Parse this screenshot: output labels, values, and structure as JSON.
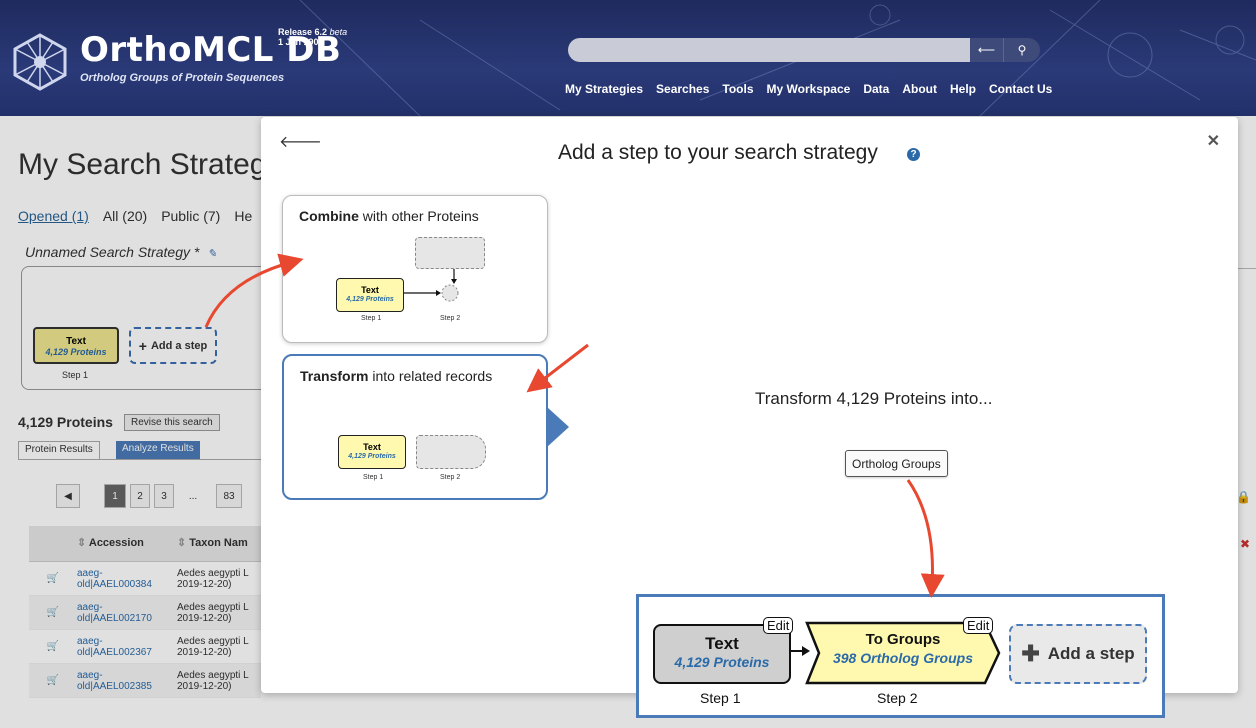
{
  "header": {
    "title": "OrthoMCL DB",
    "subtitle": "Ortholog Groups of Protein Sequences",
    "release": "Release 6.2",
    "release_tag": "beta",
    "release_date": "1 Jan 1900",
    "nav": [
      "My Strategies",
      "Searches",
      "Tools",
      "My Workspace",
      "Data",
      "About",
      "Help",
      "Contact Us"
    ]
  },
  "page": {
    "title": "My Search Strateg",
    "tabs": [
      "Opened (1)",
      "All (20)",
      "Public (7)",
      "He"
    ],
    "strategy_name": "Unnamed Search Strategy *",
    "step": {
      "title": "Text",
      "count": "4,129 Proteins",
      "label": "Step 1"
    },
    "add_step": "Add a step",
    "results_count": "4,129 Proteins",
    "revise": "Revise this search",
    "result_tabs": [
      "Protein Results",
      "Analyze Results"
    ],
    "pager": [
      "1",
      "2",
      "3",
      "...",
      "83"
    ],
    "table": {
      "headers": [
        "Accession",
        "Taxon Nam"
      ],
      "rows": [
        {
          "accession": "aaeg-old|AAEL000384",
          "taxon": "Aedes aegypti L 2019-12-20)"
        },
        {
          "accession": "aaeg-old|AAEL002170",
          "taxon": "Aedes aegypti L 2019-12-20)"
        },
        {
          "accession": "aaeg-old|AAEL002367",
          "taxon": "Aedes aegypti L 2019-12-20)"
        },
        {
          "accession": "aaeg-old|AAEL002385",
          "taxon": "Aedes aegypti L 2019-12-20)"
        }
      ]
    }
  },
  "modal": {
    "title": "Add a step to your search strategy",
    "combine": {
      "title_bold": "Combine",
      "title_rest": " with other Proteins",
      "step_title": "Text",
      "step_count": "4,129 Proteins",
      "step1": "Step 1",
      "step2": "Step 2"
    },
    "transform": {
      "title_bold": "Transform",
      "title_rest": " into related records",
      "step_title": "Text",
      "step_count": "4,129 Proteins",
      "step1": "Step 1",
      "step2": "Step 2"
    },
    "transform_heading": "Transform 4,129 Proteins into...",
    "option_button": "Ortholog Groups"
  },
  "result": {
    "step1_title": "Text",
    "step1_count": "4,129 Proteins",
    "step1_label": "Step 1",
    "step2_title": "To Groups",
    "step2_count": "398 Ortholog Groups",
    "step2_label": "Step 2",
    "edit": "Edit",
    "add_step": "Add a step"
  },
  "colors": {
    "header_bg": "#2a3a78",
    "accent_blue": "#4a7ab8",
    "step_yellow": "#fff9b0",
    "annotation_red": "#e8482f"
  }
}
